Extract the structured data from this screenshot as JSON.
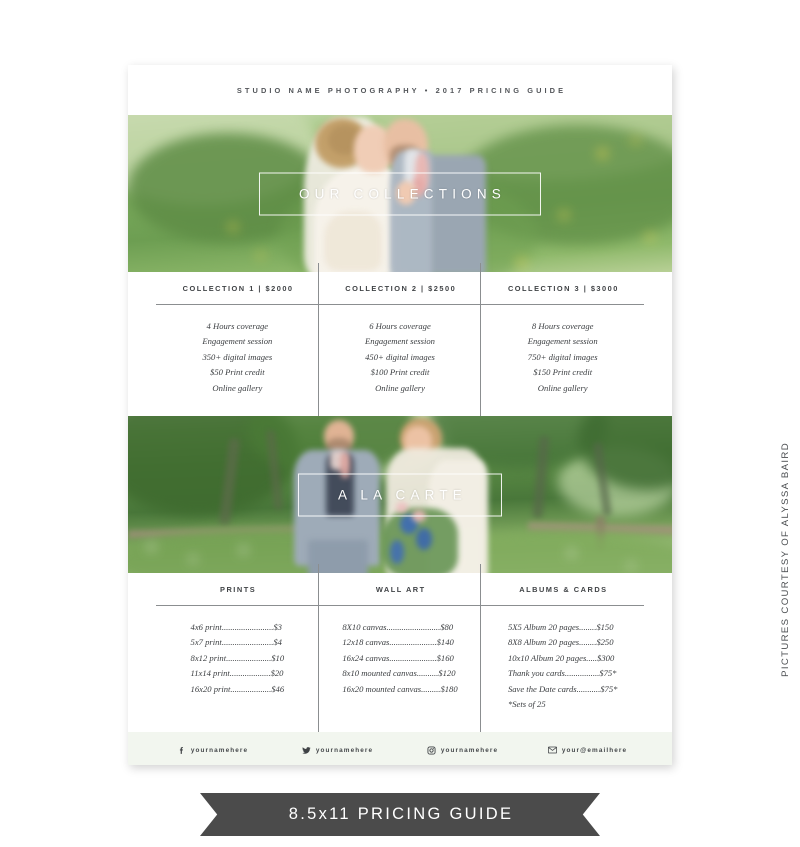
{
  "document": {
    "header_text": "STUDIO NAME PHOTOGRAPHY  •  2017 PRICING GUIDE"
  },
  "hero_collections": {
    "caption": "OUR COLLECTIONS",
    "alt": "Bride and groom touching foreheads in a green hillside meadow"
  },
  "hero_alacarte": {
    "caption": "A LA CARTE",
    "alt": "Bride and groom holding hands in a leafy park with a wooden fence"
  },
  "collections": [
    {
      "title": "COLLECTION 1 | $2000",
      "items": [
        "4 Hours coverage",
        "Engagement session",
        "350+ digital images",
        "$50 Print credit",
        "Online gallery"
      ]
    },
    {
      "title": "COLLECTION 2 | $2500",
      "items": [
        "6 Hours coverage",
        "Engagement session",
        "450+ digital images",
        "$100 Print credit",
        "Online gallery"
      ]
    },
    {
      "title": "COLLECTION 3 | $3000",
      "items": [
        "8 Hours coverage",
        "Engagement session",
        "750+ digital images",
        "$150 Print credit",
        "Online gallery"
      ]
    }
  ],
  "alacarte": [
    {
      "title": "PRINTS",
      "items": [
        "4x6 print........................$3",
        "5x7 print........................$4",
        "8x12 print.....................$10",
        "11x14 print...................$20",
        "16x20 print...................$46"
      ]
    },
    {
      "title": "WALL ART",
      "items": [
        "8X10 canvas.........................$80",
        "12x18 canvas......................$140",
        "16x24 canvas......................$160",
        "8x10 mounted canvas..........$120",
        "16x20 mounted canvas.........$180"
      ]
    },
    {
      "title": "ALBUMS & CARDS",
      "items": [
        "5X5 Album 20 pages........$150",
        "8X8 Album 20 pages........$250",
        "10x10 Album 20 pages.....$300",
        "Thank you cards................$75*",
        "Save the Date cards...........$75*",
        "*Sets of 25"
      ]
    }
  ],
  "footer": {
    "social": [
      {
        "icon": "facebook-icon",
        "handle": "yournamehere"
      },
      {
        "icon": "twitter-icon",
        "handle": "yournamehere"
      },
      {
        "icon": "instagram-icon",
        "handle": "yournamehere"
      },
      {
        "icon": "email-icon",
        "handle": "your@emailhere"
      }
    ]
  },
  "credit": {
    "text": "PICTURES COURTESY OF ALYSSA BAIRD"
  },
  "ribbon": {
    "label": "8.5x11  PRICING GUIDE"
  },
  "colors": {
    "page_background": "#ffffff",
    "canvas_background": "#ffffff",
    "rule": "#8b8e90",
    "heading_text": "#404346",
    "body_text": "#3b3e41",
    "footer_background": "#f2f6ef",
    "ribbon_background": "#4b4b4b",
    "ribbon_text": "#ffffff"
  }
}
